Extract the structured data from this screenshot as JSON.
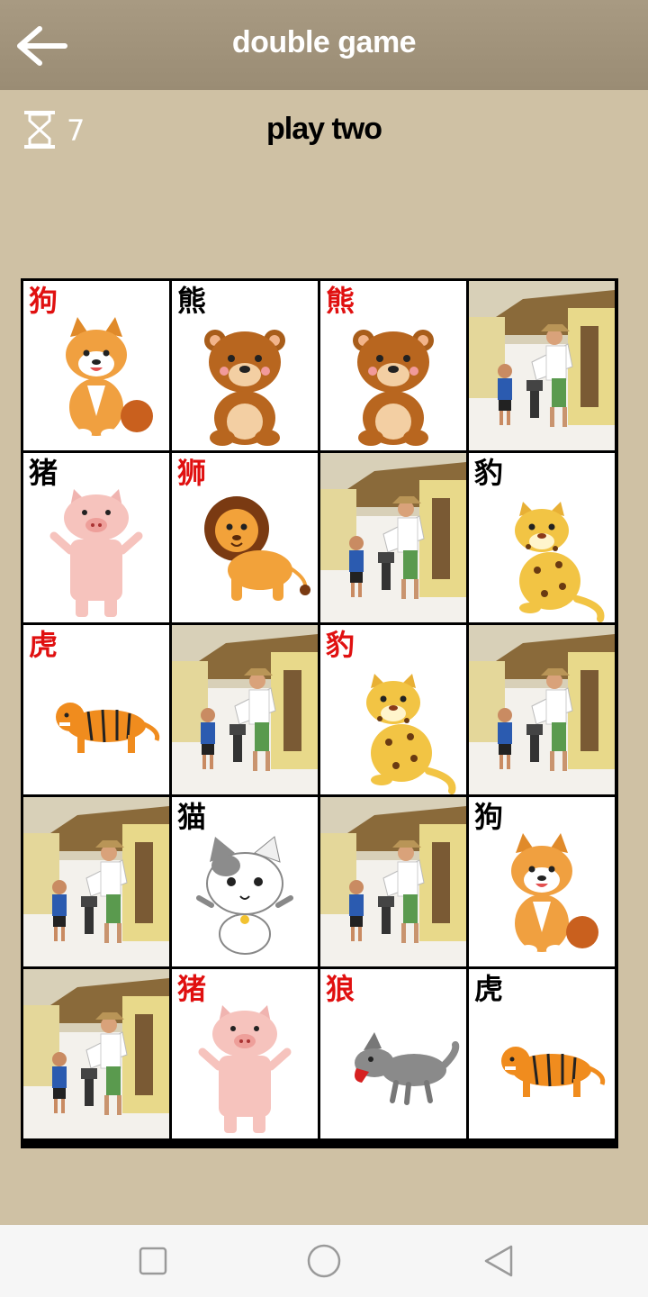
{
  "header": {
    "title": "double game",
    "back_icon": "arrow-left-icon"
  },
  "status": {
    "timer_icon": "hourglass-icon",
    "timer_value": "7",
    "mode_label": "play two"
  },
  "board": {
    "cards": [
      {
        "state": "open",
        "label": "狗",
        "label_color": "red",
        "animal": "dog"
      },
      {
        "state": "open",
        "label": "熊",
        "label_color": "black",
        "animal": "bear"
      },
      {
        "state": "open",
        "label": "熊",
        "label_color": "red",
        "animal": "bear"
      },
      {
        "state": "hidden",
        "label": "",
        "label_color": "",
        "animal": "card-back"
      },
      {
        "state": "open",
        "label": "猪",
        "label_color": "black",
        "animal": "pig"
      },
      {
        "state": "open",
        "label": "狮",
        "label_color": "red",
        "animal": "lion"
      },
      {
        "state": "hidden",
        "label": "",
        "label_color": "",
        "animal": "card-back"
      },
      {
        "state": "open",
        "label": "豹",
        "label_color": "black",
        "animal": "leopard"
      },
      {
        "state": "open",
        "label": "虎",
        "label_color": "red",
        "animal": "tiger"
      },
      {
        "state": "hidden",
        "label": "",
        "label_color": "",
        "animal": "card-back"
      },
      {
        "state": "open",
        "label": "豹",
        "label_color": "red",
        "animal": "leopard"
      },
      {
        "state": "hidden",
        "label": "",
        "label_color": "",
        "animal": "card-back"
      },
      {
        "state": "hidden",
        "label": "",
        "label_color": "",
        "animal": "card-back"
      },
      {
        "state": "open",
        "label": "猫",
        "label_color": "black",
        "animal": "cat"
      },
      {
        "state": "hidden",
        "label": "",
        "label_color": "",
        "animal": "card-back"
      },
      {
        "state": "open",
        "label": "狗",
        "label_color": "black",
        "animal": "dog"
      },
      {
        "state": "hidden",
        "label": "",
        "label_color": "",
        "animal": "card-back"
      },
      {
        "state": "open",
        "label": "猪",
        "label_color": "red",
        "animal": "pig"
      },
      {
        "state": "open",
        "label": "狼",
        "label_color": "red",
        "animal": "wolf"
      },
      {
        "state": "open",
        "label": "虎",
        "label_color": "black",
        "animal": "tiger"
      }
    ]
  },
  "navbar": {
    "items": [
      "recent-apps-icon",
      "home-icon",
      "back-triangle-icon"
    ]
  },
  "colors": {
    "background": "#cfc1a4",
    "header": "#a89a82",
    "label_red": "#e01010"
  }
}
